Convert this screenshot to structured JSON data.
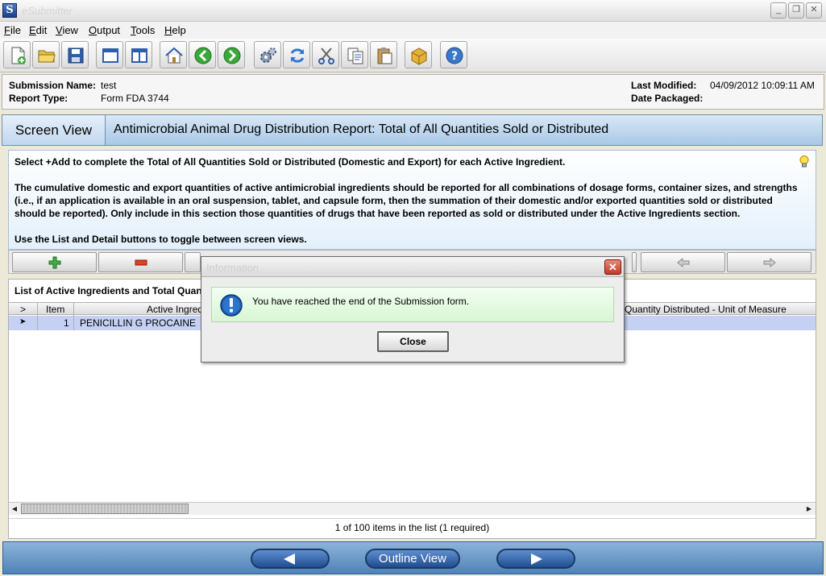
{
  "window": {
    "title": "eSubmitter",
    "minimize_label": "_",
    "restore_label": "❐",
    "close_label": "✕"
  },
  "menu": [
    "File",
    "Edit",
    "View",
    "Output",
    "Tools",
    "Help"
  ],
  "toolbar_icons": [
    "new-document-icon",
    "open-folder-icon",
    "save-icon",
    "window-icon",
    "split-view-icon",
    "home-icon",
    "back-arrow-icon",
    "forward-arrow-icon",
    "settings-gears-icon",
    "refresh-icon",
    "cut-icon",
    "copy-icon",
    "paste-icon",
    "package-icon",
    "help-icon"
  ],
  "submission": {
    "name_label": "Submission Name:",
    "name_value": "test",
    "report_type_label": "Report Type:",
    "report_type_value": "Form FDA 3744",
    "last_modified_label": "Last Modified:",
    "last_modified_value": "04/09/2012 10:09:11 AM",
    "date_packaged_label": "Date Packaged:",
    "date_packaged_value": ""
  },
  "screen": {
    "label": "Screen View",
    "title": "Antimicrobial Animal Drug Distribution Report: Total of All Quantities Sold or Distributed"
  },
  "instructions": {
    "line1": "Select +Add to complete the Total of All Quantities Sold or Distributed (Domestic and Export) for each Active Ingredient.",
    "paragraph": "The cumulative domestic and export quantities of active antimicrobial ingredients should be reported for all combinations of dosage forms, container sizes, and strengths (i.e., if an application is available in an oral suspension, tablet, and capsule form, then the summation of their domestic and/or exported quantities sold or distributed should be reported). Only include in this section those quantities of drugs that have been reported as sold or distributed under the Active Ingredients section.",
    "line3": "Use the List and Detail buttons to toggle between screen views."
  },
  "list": {
    "title": "List of Active Ingredients and Total Quant",
    "columns": {
      "marker": ">",
      "item": "Item",
      "ingredient": "Active Ingred",
      "uom": "Quantity Distributed - Unit of Measure"
    },
    "rows": [
      {
        "marker": "➤",
        "item": "1",
        "ingredient": "PENICILLIN G PROCAINE"
      }
    ],
    "footer": "1 of 100 items in the list (1 required)"
  },
  "nav": {
    "outline_label": "Outline View"
  },
  "dialog": {
    "title": "Information",
    "message": "You have reached the end of the Submission form.",
    "close_label": "Close",
    "close_x": "✕"
  },
  "colors": {
    "accent": "#3a6ea5",
    "row_selected": "#c4d1f2",
    "dialog_message_bg": "#dcf6d8"
  }
}
